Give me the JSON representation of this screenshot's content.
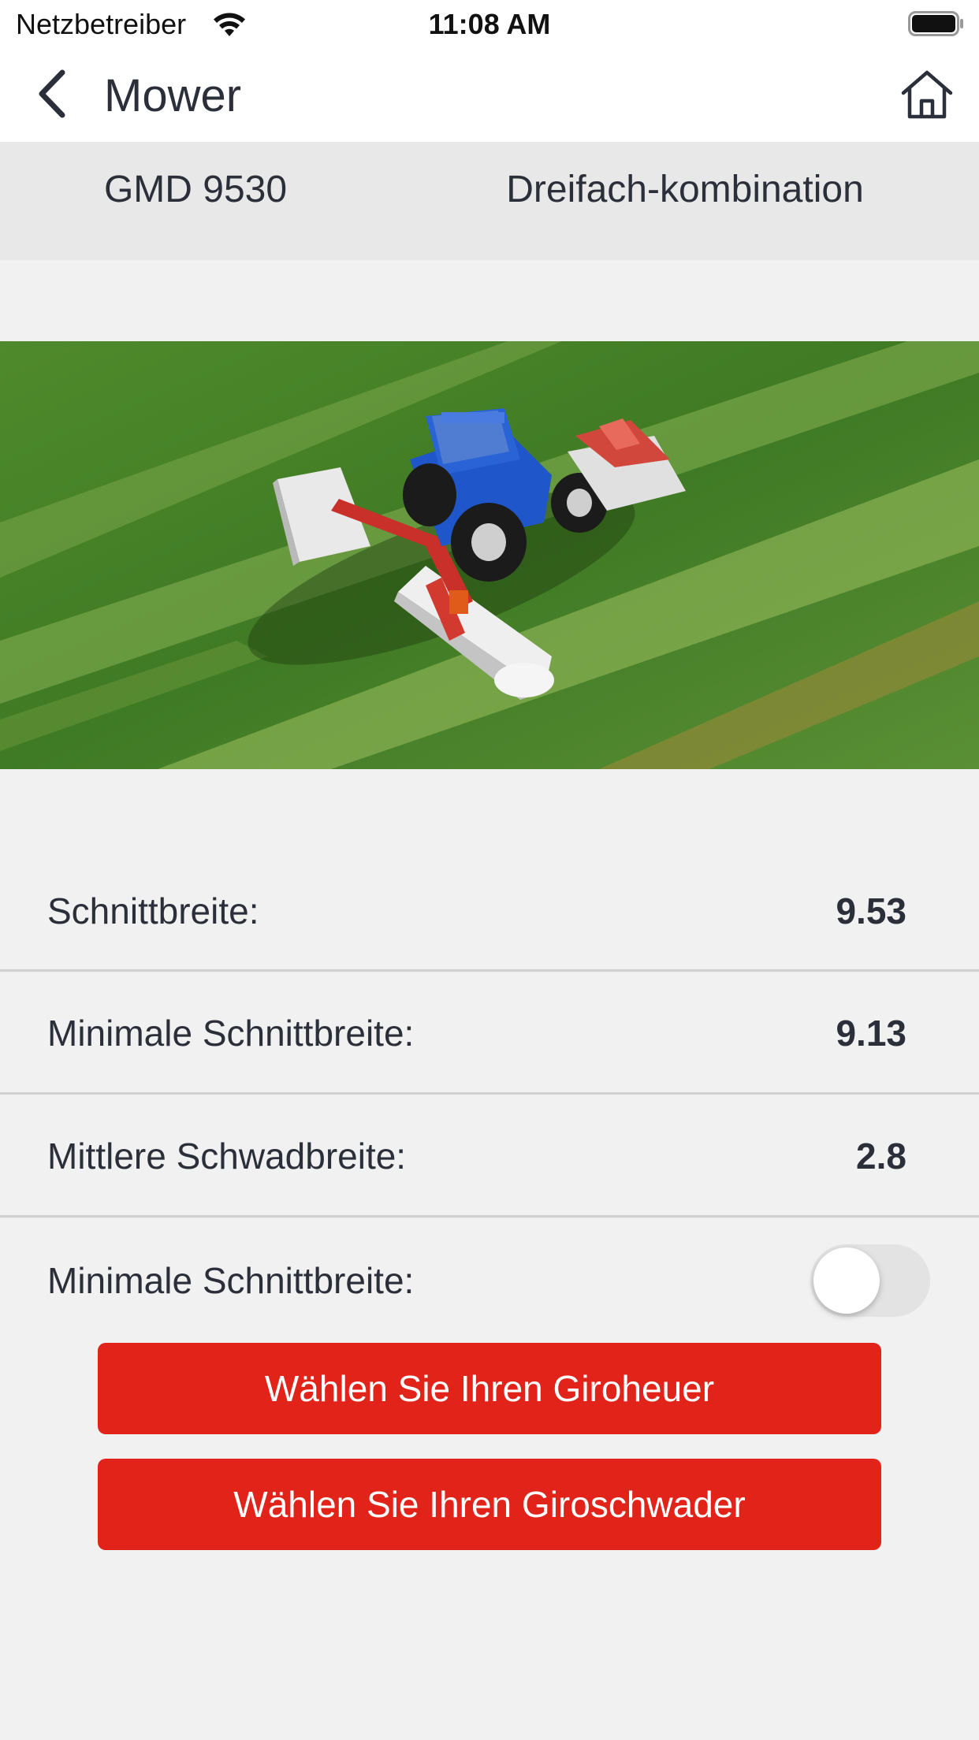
{
  "status_bar": {
    "carrier": "Netzbetreiber",
    "time": "11:08 AM",
    "wifi_icon": "wifi-icon",
    "battery_icon": "battery-full-icon"
  },
  "nav": {
    "title": "Mower",
    "back_icon": "chevron-left-icon",
    "home_icon": "home-icon"
  },
  "model": {
    "name": "GMD 9530",
    "type": "Dreifach-kombination"
  },
  "photo": {
    "subject": "tractor with triple mower combination in a field"
  },
  "specs": [
    {
      "label": "Schnittbreite:",
      "value": "9.53"
    },
    {
      "label": "Minimale Schnittbreite:",
      "value": "9.13"
    },
    {
      "label": "Mittlere Schwadbreite:",
      "value": "2.8"
    }
  ],
  "toggle": {
    "label": "Minimale Schnittbreite:",
    "on": false
  },
  "buttons": {
    "tedder": "Wählen Sie Ihren Giroheuer",
    "rake": "Wählen Sie Ihren Giroschwader"
  },
  "colors": {
    "accent": "#e2231a",
    "background": "#f1f1f1",
    "text": "#2b2f3a"
  }
}
